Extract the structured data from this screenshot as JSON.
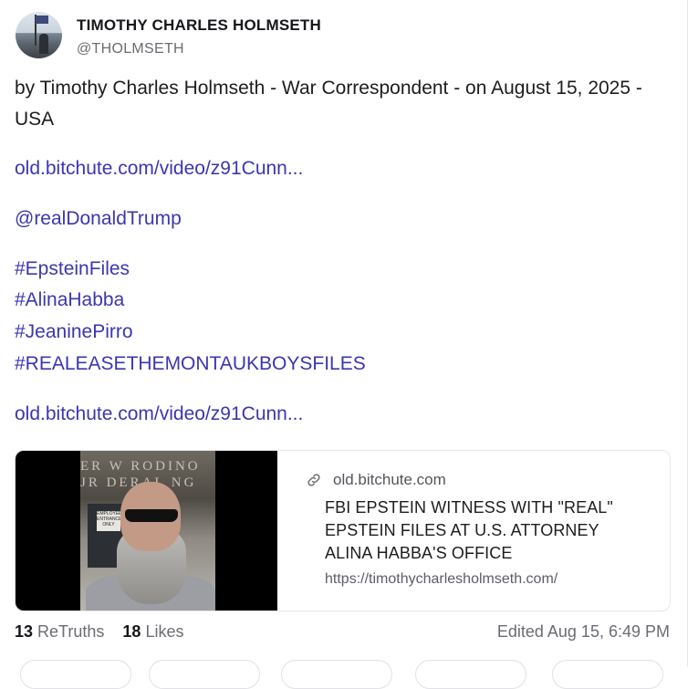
{
  "author": {
    "name": "TIMOTHY CHARLES HOLMSETH",
    "handle": "@THOLMSETH"
  },
  "post": {
    "text": "by Timothy Charles Holmseth - War Correspondent - on August 15, 2025 - USA",
    "link1": "old.bitchute.com/video/z91Cunn...",
    "mention": "@realDonaldTrump",
    "hashtags": [
      "#EpsteinFiles",
      "#AlinaHabba",
      "#JeaninePirro",
      "#REALEASETHEMONTAUKBOYSFILES"
    ],
    "link2": "old.bitchute.com/video/z91Cunn..."
  },
  "card": {
    "domain": "old.bitchute.com",
    "title": "FBI EPSTEIN WITNESS WITH \"REAL\" EPSTEIN FILES AT U.S. ATTORNEY ALINA HABBA'S OFFICE",
    "url": "https://timothycharlesholmseth.com/",
    "thumb_sign": "ER W RODINO JR DERAL   NG",
    "thumb_plate": "EMPLOYEE ENTRANCE ONLY",
    "link_icon": "link-chain-icon"
  },
  "stats": {
    "retruths_count": "13",
    "retruths_label": "ReTruths",
    "likes_count": "18",
    "likes_label": "Likes",
    "edited": "Edited Aug 15, 6:49 PM"
  },
  "colors": {
    "link": "#3b36b0",
    "text": "#1d1d1f",
    "muted": "#6b6b74"
  }
}
